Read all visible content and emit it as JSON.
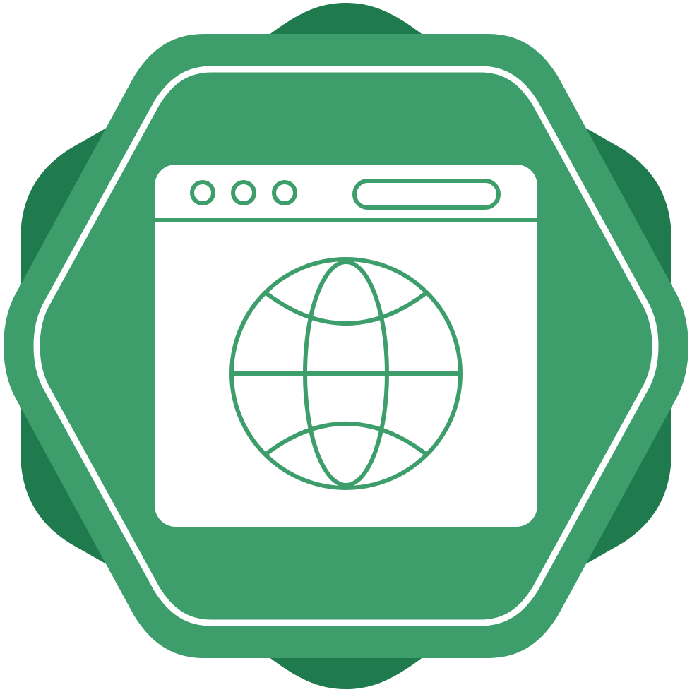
{
  "icon": {
    "name": "web-browser-globe-badge",
    "colors": {
      "badge_dark": "#1f7a4d",
      "badge_light": "#3d9e6c",
      "foreground": "#ffffff"
    },
    "parts": {
      "window_dots": [
        "dot-1",
        "dot-2",
        "dot-3"
      ],
      "has_address_bar": true,
      "globe_symbol": "globe-icon"
    }
  }
}
